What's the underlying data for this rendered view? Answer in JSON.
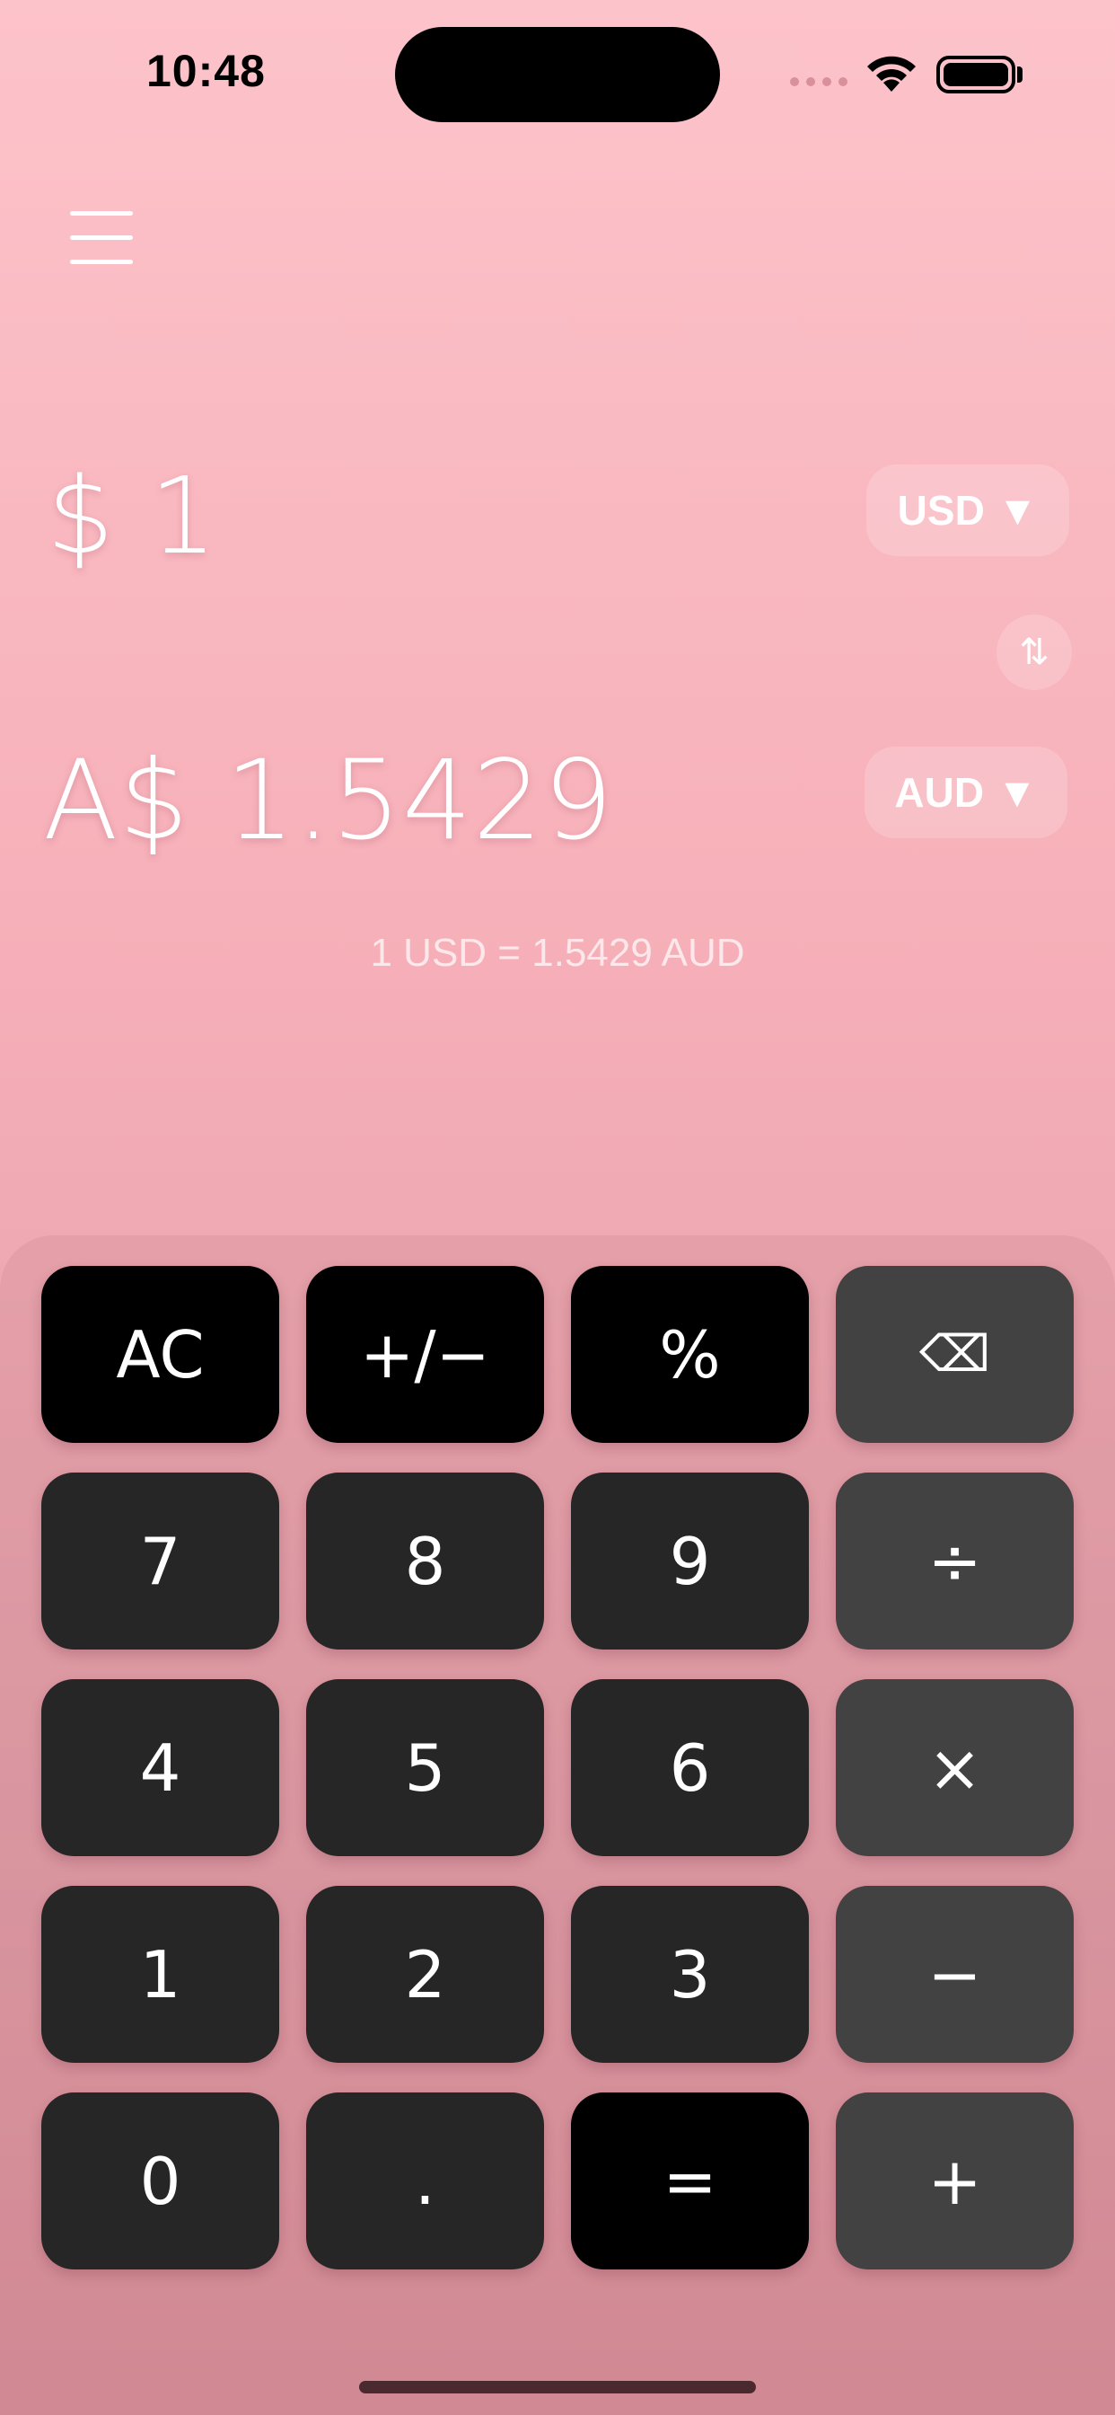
{
  "status_bar": {
    "time": "10:48"
  },
  "converter": {
    "from_amount": "$ 1",
    "from_currency": "USD",
    "to_amount": "A$ 1.5429",
    "to_currency": "AUD",
    "dropdown_glyph": "▼",
    "swap_glyph": "⇅",
    "rate_text": "1 USD = 1.5429 AUD"
  },
  "keypad": {
    "keys": [
      "AC",
      "+/−",
      "%",
      "⌫",
      "7",
      "8",
      "9",
      "÷",
      "4",
      "5",
      "6",
      "×",
      "1",
      "2",
      "3",
      "−",
      "0",
      ".",
      "=",
      "+"
    ]
  }
}
